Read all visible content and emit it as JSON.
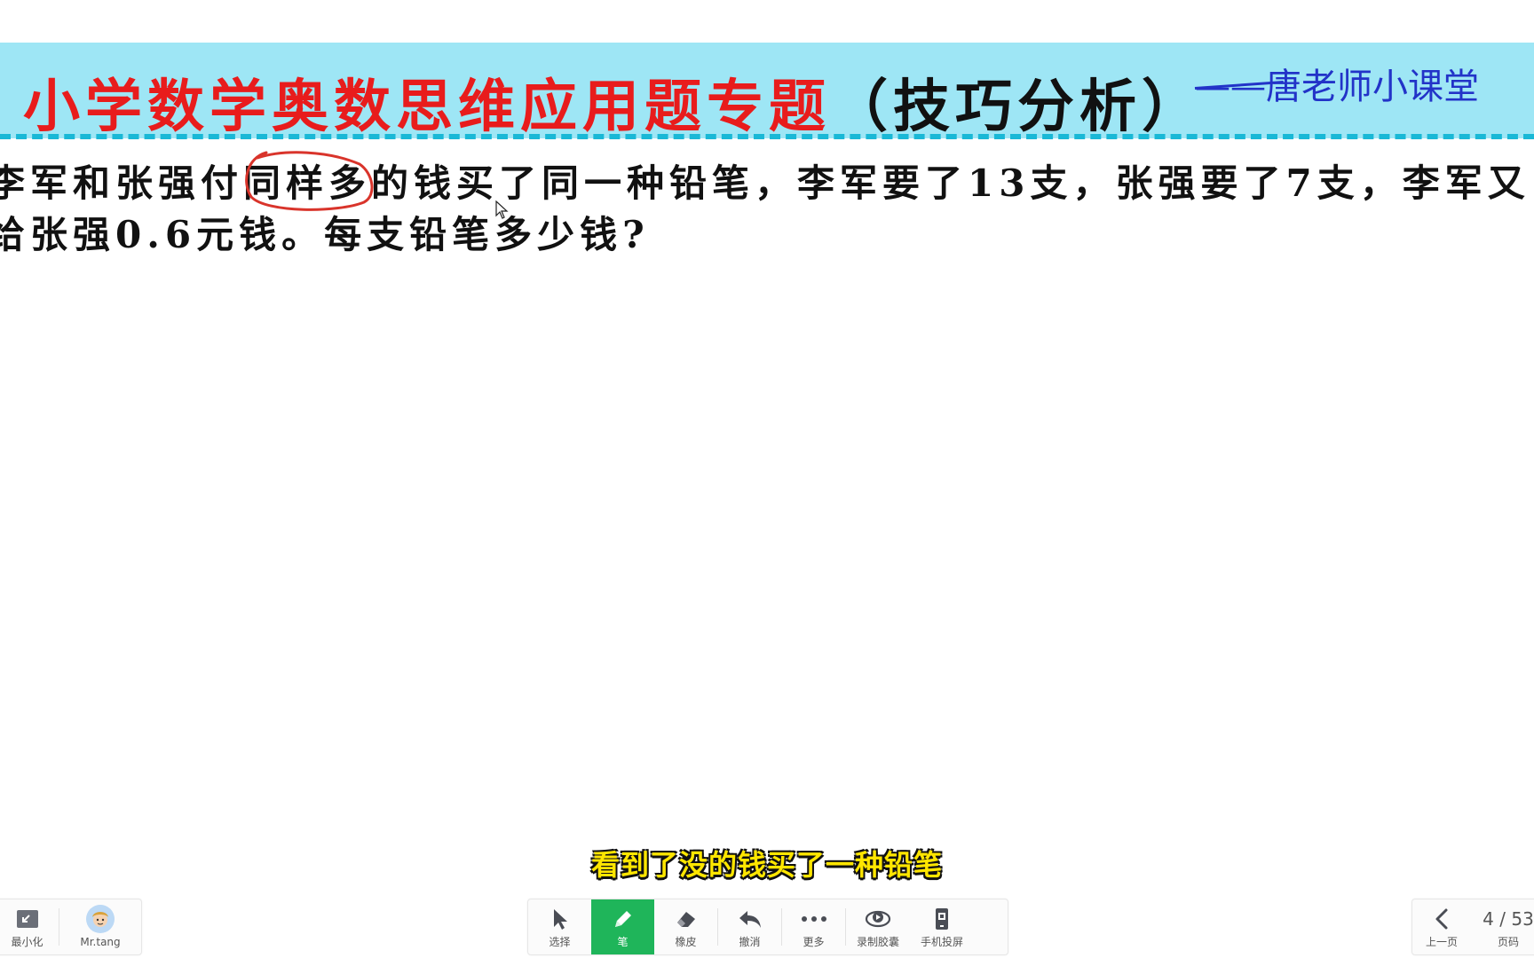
{
  "banner": {
    "title_main": "小学数学奥数思维应用题专题",
    "title_paren": "（技巧分析）",
    "signature": "——唐老师小课堂"
  },
  "problem": {
    "line1_a": "李军和张强付",
    "line1_circled": "同样多",
    "line1_b": "的钱买了同一种铅笔，李军要了13支，张强要了7支，李军又",
    "line2": "给张强0.6元钱。每支铅笔多少钱?"
  },
  "subtitle": "看到了没的钱买了一种铅笔",
  "toolbar_left": {
    "minimize_label": "最小化",
    "user_label": "Mr.tang"
  },
  "toolbar_center": {
    "select_label": "选择",
    "pen_label": "笔",
    "eraser_label": "橡皮",
    "undo_label": "撤消",
    "more_label": "更多",
    "record_label": "录制胶囊",
    "cast_label": "手机投屏"
  },
  "toolbar_right": {
    "prev_label": "上一页",
    "page_indicator": "4 / 53",
    "page_label": "页码"
  },
  "colors": {
    "banner_bg": "#9ee6f5",
    "title_red": "#e81c1c",
    "signature_blue": "#2233c8",
    "pen_active": "#1fb55a",
    "annotation_red": "#d9342b",
    "subtitle_yellow": "#ffe600"
  }
}
